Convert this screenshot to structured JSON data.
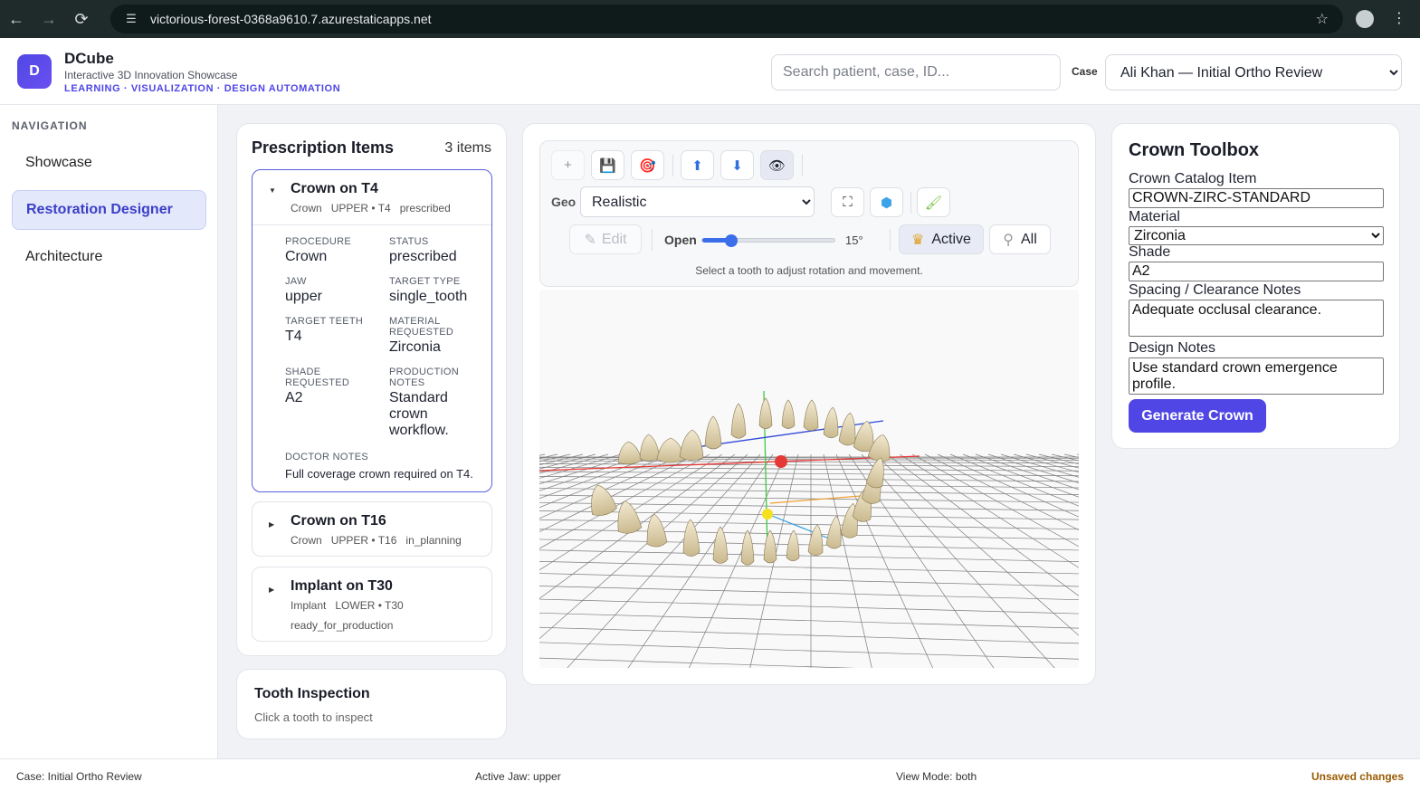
{
  "browser": {
    "url": "victorious-forest-0368a9610.7.azurestaticapps.net",
    "back_icon": "←",
    "forward_icon": "→",
    "reload_icon": "⟳",
    "site_icon": "☰",
    "star_icon": "☆",
    "menu_icon": "⋮"
  },
  "header": {
    "logo_letter": "D",
    "brand_name": "DCube",
    "brand_subtitle": "Interactive 3D Innovation Showcase",
    "brand_tagline": "LEARNING · VISUALIZATION · DESIGN AUTOMATION",
    "search_placeholder": "Search patient, case, ID...",
    "case_label": "Case",
    "case_selected": "Ali Khan — Initial Ortho Review"
  },
  "sidebar": {
    "title": "NAVIGATION",
    "items": [
      {
        "label": "Showcase",
        "active": false
      },
      {
        "label": "Restoration Designer",
        "active": true
      },
      {
        "label": "Architecture",
        "active": false
      }
    ]
  },
  "prescription": {
    "title": "Prescription Items",
    "count": "3 items",
    "items": [
      {
        "name": "Crown on T4",
        "type": "Crown",
        "location": "UPPER • T4",
        "status": "prescribed",
        "expanded": true,
        "details": {
          "procedure_label": "PROCEDURE",
          "procedure": "Crown",
          "status_label": "STATUS",
          "status": "prescribed",
          "jaw_label": "JAW",
          "jaw": "upper",
          "target_type_label": "TARGET TYPE",
          "target_type": "single_tooth",
          "target_teeth_label": "TARGET TEETH",
          "target_teeth": "T4",
          "material_label_1": "MATERIAL",
          "material_label_2": "REQUESTED",
          "material": "Zirconia",
          "shade_label_1": "SHADE",
          "shade_label_2": "REQUESTED",
          "shade": "A2",
          "production_label_1": "PRODUCTION",
          "production_label_2": "NOTES",
          "production_1": "Standard",
          "production_2": "crown",
          "production_3": "workflow.",
          "doctor_notes_label": "DOCTOR NOTES",
          "doctor_notes": "Full coverage crown required on T4."
        }
      },
      {
        "name": "Crown on T16",
        "type": "Crown",
        "location": "UPPER • T16",
        "status": "in_planning",
        "expanded": false
      },
      {
        "name": "Implant on T30",
        "type": "Implant",
        "location": "LOWER • T30",
        "status": "ready_for_production",
        "expanded": false
      }
    ]
  },
  "tooth_inspection": {
    "title": "Tooth Inspection",
    "subtitle": "Click a tooth to inspect"
  },
  "viewer": {
    "icons": {
      "add": "+",
      "save": "💾",
      "target": "🎯",
      "up": "⬆",
      "down": "⬇",
      "eye": "👁",
      "fit": "⛶",
      "cube": "⬢",
      "brush": "🖌",
      "pencil": "✎",
      "crown": "♛",
      "tooth": "⚲"
    },
    "geo_label": "Geo",
    "geo_selected": "Realistic",
    "edit_label": "Edit",
    "open_label": "Open",
    "open_degrees": "15°",
    "open_fraction": 0.15,
    "active_label": "Active",
    "all_label": "All",
    "hint": "Select a tooth to adjust rotation and movement."
  },
  "crown_toolbox": {
    "title": "Crown Toolbox",
    "catalog_label": "Crown Catalog Item",
    "catalog_value": "CROWN-ZIRC-STANDARD",
    "material_label": "Material",
    "material_value": "Zirconia",
    "shade_label": "Shade",
    "shade_value": "A2",
    "spacing_label": "Spacing / Clearance Notes",
    "spacing_value": "Adequate occlusal clearance.",
    "design_label": "Design Notes",
    "design_value": "Use standard crown emergence profile.",
    "generate_label": "Generate Crown"
  },
  "status_bar": {
    "case": "Case: Initial Ortho Review",
    "active_jaw": "Active Jaw: upper",
    "view_mode": "View Mode: both",
    "unsaved": "Unsaved changes"
  },
  "colors": {
    "accent": "#4f46e5",
    "x_axis": "#e53935",
    "y_axis": "#43c843",
    "z_axis": "#2f49d8",
    "tooth": "#e6dcc0"
  }
}
